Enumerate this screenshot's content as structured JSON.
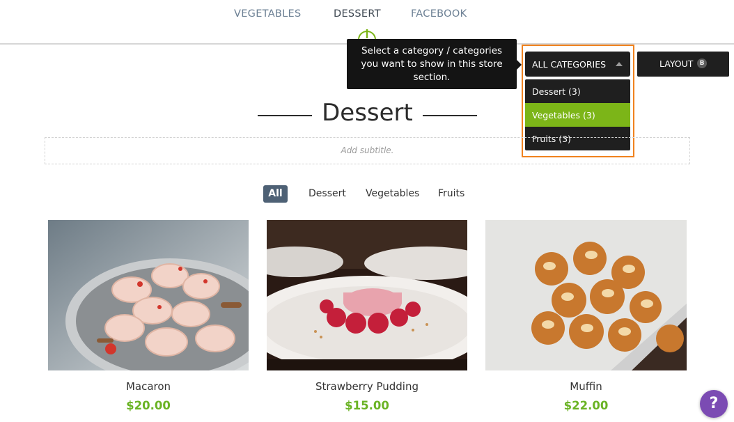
{
  "nav": {
    "items": [
      {
        "label": "VEGETABLES"
      },
      {
        "label": "DESSERT"
      },
      {
        "label": "FACEBOOK"
      }
    ]
  },
  "tooltip": {
    "text": "Select a category / categories you want to show in this store section."
  },
  "category_select": {
    "selected": "ALL CATEGORIES",
    "options": [
      {
        "label": "Dessert (3)"
      },
      {
        "label": "Vegetables (3)"
      },
      {
        "label": "Fruits (3)"
      }
    ],
    "highlighted_option": "Vegetables (3)"
  },
  "layout_button": {
    "label": "LAYOUT",
    "badge": "B"
  },
  "section": {
    "title": "Dessert",
    "subtitle_placeholder": "Add subtitle."
  },
  "filters": [
    {
      "label": "All",
      "active": true
    },
    {
      "label": "Dessert"
    },
    {
      "label": "Vegetables"
    },
    {
      "label": "Fruits"
    }
  ],
  "products": [
    {
      "name": "Macaron",
      "price": "$20.00",
      "image": "macarons-in-bowl-photo"
    },
    {
      "name": "Strawberry Pudding",
      "price": "$15.00",
      "image": "strawberry-pudding-plate-photo"
    },
    {
      "name": "Muffin",
      "price": "$22.00",
      "image": "muffins-on-cloth-photo"
    }
  ],
  "help": {
    "label": "?"
  },
  "colors": {
    "accent_green": "#6ab324",
    "highlight_orange": "#f0821e",
    "dark_ui": "#1f1f1f",
    "active_filter": "#4e6175",
    "help_purple": "#7b4bb3"
  }
}
